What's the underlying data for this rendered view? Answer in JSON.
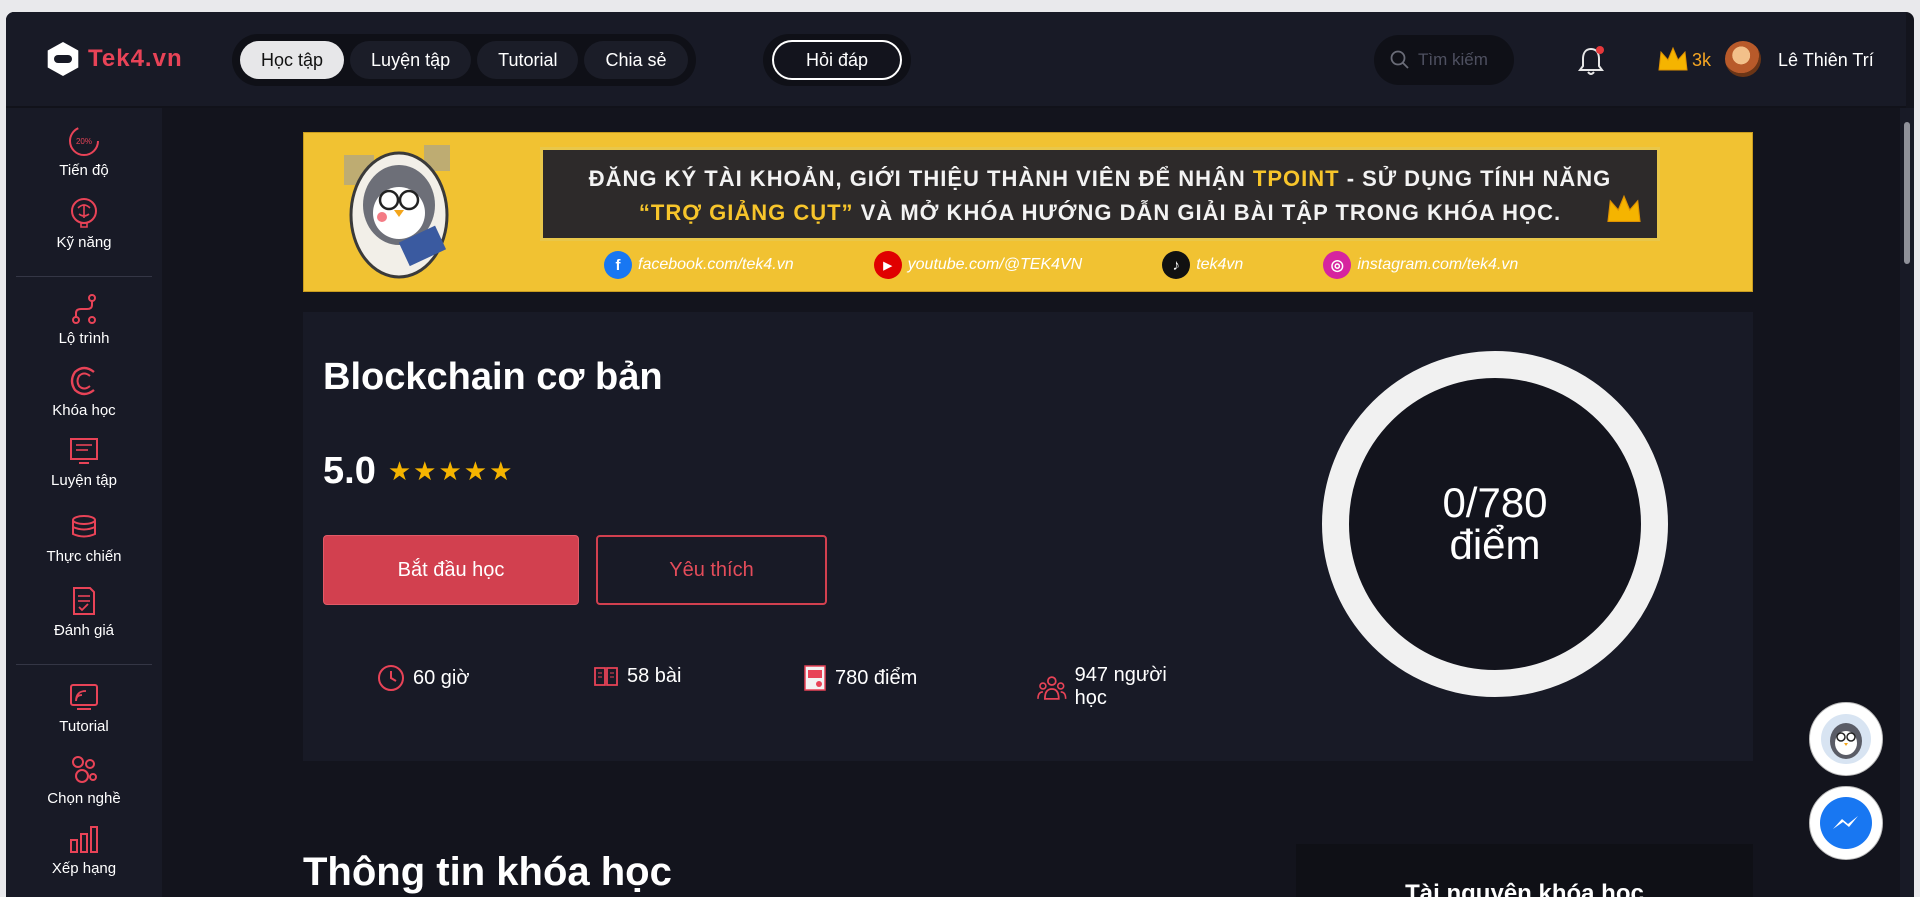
{
  "logo": {
    "text": "Tek4.vn"
  },
  "nav": {
    "items": [
      {
        "label": "Học tập",
        "active": true
      },
      {
        "label": "Luyện tập",
        "active": false
      },
      {
        "label": "Tutorial",
        "active": false
      },
      {
        "label": "Chia sẻ",
        "active": false
      }
    ],
    "qa_label": "Hỏi đáp"
  },
  "search": {
    "placeholder": "Tìm kiếm"
  },
  "user": {
    "points": "3k",
    "name": "Lê Thiên Trí",
    "icons": [
      "bell-icon",
      "crown-icon"
    ]
  },
  "sidebar": {
    "items": [
      {
        "label": "Tiến độ",
        "icon": "progress-icon",
        "badge": "20%"
      },
      {
        "label": "Kỹ năng",
        "icon": "brain-icon"
      },
      {
        "label": "Lộ trình",
        "icon": "route-icon"
      },
      {
        "label": "Khóa học",
        "icon": "course-icon"
      },
      {
        "label": "Luyện tập",
        "icon": "practice-icon"
      },
      {
        "label": "Thực chiến",
        "icon": "battle-icon"
      },
      {
        "label": "Đánh giá",
        "icon": "review-icon"
      },
      {
        "label": "Tutorial",
        "icon": "tutorial-icon"
      },
      {
        "label": "Chọn nghề",
        "icon": "career-icon"
      },
      {
        "label": "Xếp hạng",
        "icon": "ranking-icon"
      }
    ]
  },
  "banner": {
    "line1_a": "ĐĂNG KÝ TÀI KHOẢN, GIỚI THIỆU THÀNH VIÊN ĐỂ NHẬN ",
    "line1_hl": "TPOINT",
    "line1_b": " - SỬ DỤNG TÍNH NĂNG",
    "line2_hl": "“TRỢ GIẢNG CỤT”",
    "line2_b": " VÀ MỞ KHÓA HƯỚNG DẪN GIẢI BÀI TẬP TRONG KHÓA HỌC.",
    "socials": [
      {
        "text": "facebook.com/tek4.vn",
        "icon": "facebook-icon",
        "glyph": "f",
        "color": "#1877f2"
      },
      {
        "text": "youtube.com/@TEK4VN",
        "icon": "youtube-icon",
        "glyph": "▶",
        "color": "#e00000"
      },
      {
        "text": "tek4vn",
        "icon": "tiktok-icon",
        "glyph": "♪",
        "color": "#111111"
      },
      {
        "text": "instagram.com/tek4.vn",
        "icon": "instagram-icon",
        "glyph": "◎",
        "color": "#d6249f"
      }
    ]
  },
  "course": {
    "title": "Blockchain cơ bản",
    "rating": "5.0",
    "stars": 5,
    "start_label": "Bắt đầu học",
    "fav_label": "Yêu thích",
    "stats": [
      {
        "icon": "clock-icon",
        "text": "60 giờ"
      },
      {
        "icon": "book-icon",
        "text": "58 bài"
      },
      {
        "icon": "certificate-icon",
        "text": "780 điểm"
      },
      {
        "icon": "users-icon",
        "text": "947 người học"
      }
    ],
    "score": "0/780",
    "score_unit": "điểm",
    "progress": 0
  },
  "info": {
    "title": "Thông tin khóa học",
    "resources_title": "Tài nguyên khóa học"
  },
  "colors": {
    "accent": "#d2404f",
    "gold": "#f5a623",
    "bg": "#13141d",
    "panel": "#181a26"
  }
}
